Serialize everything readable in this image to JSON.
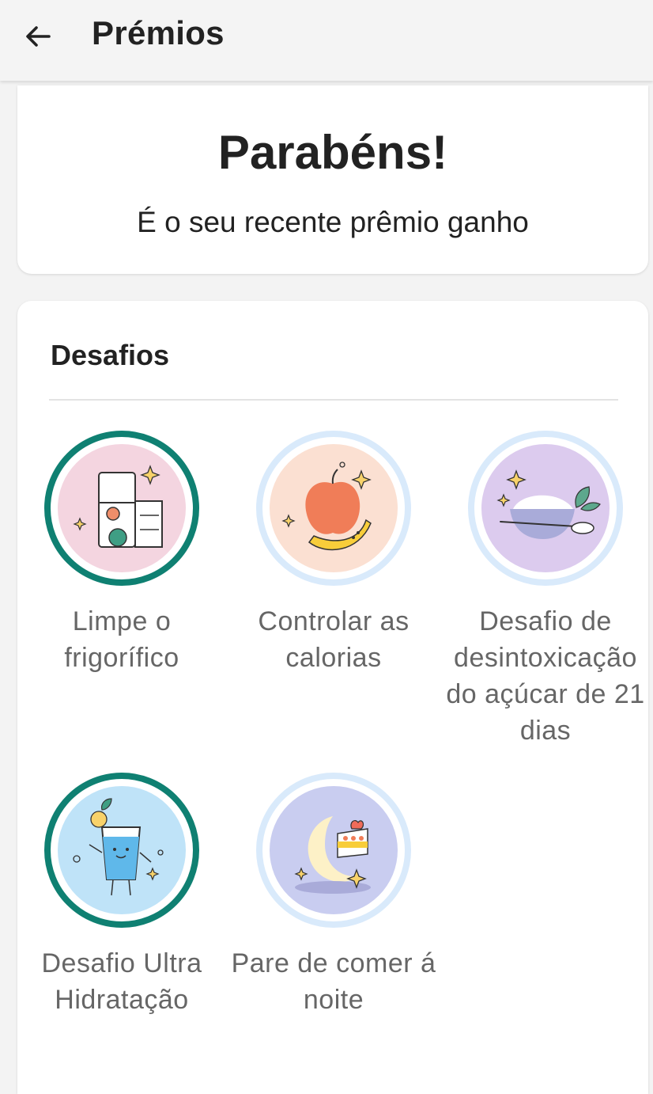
{
  "appbar": {
    "title": "Prémios",
    "back_icon": "arrow-left-icon"
  },
  "congrats": {
    "title": "Parabéns!",
    "subtitle": "É o seu recente prêmio ganho"
  },
  "challenges": {
    "section_title": "Desafios",
    "accent_earned": "#0f8072",
    "accent_unearned": "#d9eafb",
    "items": [
      {
        "label": "Limpe o frigorífico",
        "earned": true,
        "icon": "fridge-icon"
      },
      {
        "label": "Controlar as calorias",
        "earned": false,
        "icon": "apple-banana-icon"
      },
      {
        "label": "Desafio de desintoxicação do açúcar de 21 dias",
        "earned": false,
        "icon": "sugar-bowl-icon"
      },
      {
        "label": "Desafio Ultra Hidratação",
        "earned": true,
        "icon": "water-glass-icon"
      },
      {
        "label": "Pare de comer á noite",
        "earned": false,
        "icon": "moon-cake-icon"
      }
    ]
  }
}
